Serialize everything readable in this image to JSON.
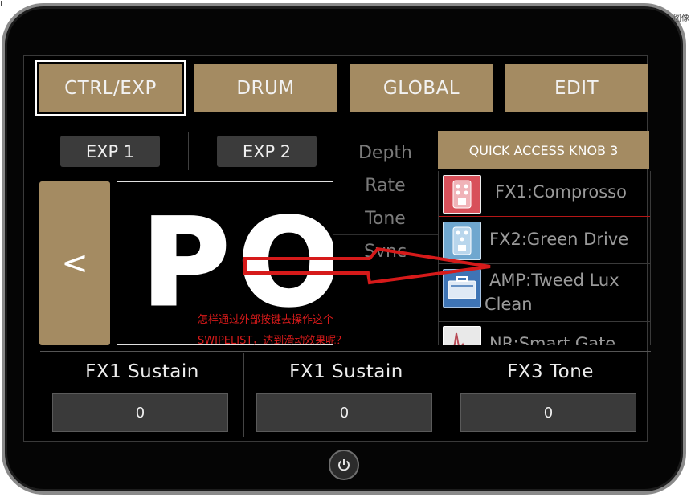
{
  "tabs": [
    {
      "label": "CTRL/EXP",
      "active": true
    },
    {
      "label": "DRUM",
      "active": false
    },
    {
      "label": "GLOBAL",
      "active": false
    },
    {
      "label": "EDIT",
      "active": false
    }
  ],
  "exp_buttons": [
    "EXP 1",
    "EXP 2"
  ],
  "prev_label": "<",
  "display_text": "PO",
  "params": [
    "Depth",
    "Rate",
    "Tone",
    "Sync"
  ],
  "quick_access": {
    "header": "QUICK ACCESS KNOB 3",
    "items": [
      {
        "label": "FX1:Comprosso",
        "icon": "compressor-pedal-icon",
        "color": "#d8505a"
      },
      {
        "label": "FX2:Green Drive",
        "icon": "overdrive-pedal-icon",
        "color": "#6fa7cf"
      },
      {
        "label": "AMP:Tweed Lux",
        "label2": "Clean",
        "icon": "amp-icon",
        "color": "#3e74b5"
      },
      {
        "label": "NR:Smart Gate",
        "icon": "noise-gate-icon",
        "color": "#b84a55"
      }
    ]
  },
  "slots": [
    {
      "title": "FX1  Sustain",
      "value": "0"
    },
    {
      "title": "FX1  Sustain",
      "value": "0"
    },
    {
      "title": "FX3  Tone",
      "value": "0"
    }
  ],
  "annotation": {
    "line1": "怎样通过外部按键去操作这个",
    "line2": "SWIPELIST，达到滑动效果呢？",
    "color": "#d61a1a"
  },
  "corner_left": "I",
  "corner_right": "图像"
}
